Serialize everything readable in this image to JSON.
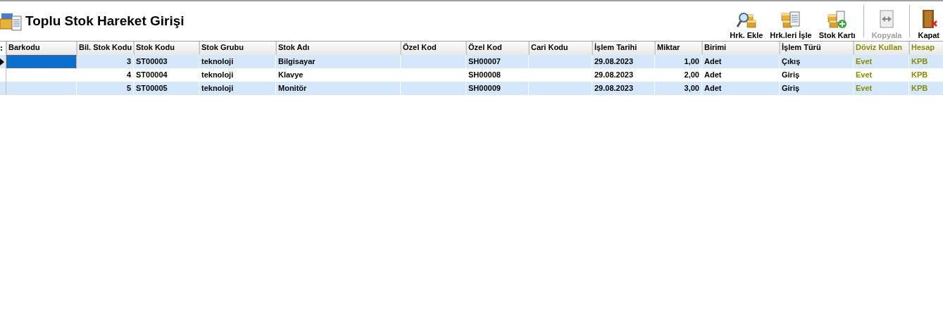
{
  "window": {
    "title": "Toplu Stok Hareket Girişi"
  },
  "toolbar": [
    {
      "label": "Hrk. Ekle",
      "kind": "search",
      "disabled": false
    },
    {
      "label": "Hrk.leri İşle",
      "kind": "document",
      "disabled": false
    },
    {
      "label": "Stok Kartı",
      "kind": "add",
      "disabled": false,
      "separator_after": true
    },
    {
      "label": "Kopyala",
      "kind": "copy",
      "disabled": true,
      "separator_after": true
    },
    {
      "label": "Kapat",
      "kind": "door",
      "disabled": false
    }
  ],
  "table": {
    "columns": [
      {
        "label": "Barkodu",
        "highlight": false
      },
      {
        "label": "Bil. Stok Kodu",
        "numeric": true,
        "highlight": false
      },
      {
        "label": "Stok Kodu",
        "numeric": false,
        "highlight": false
      },
      {
        "label": "Stok Grubu",
        "numeric": false,
        "highlight": false
      },
      {
        "label": "Stok Adı",
        "numeric": false,
        "highlight": false
      },
      {
        "label": "Özel Kod",
        "highlight": false
      },
      {
        "label": "Özel Kod",
        "numeric": false,
        "highlight": false
      },
      {
        "label": "Cari Kodu",
        "highlight": false
      },
      {
        "label": "İşlem Tarihi",
        "numeric": false,
        "highlight": false
      },
      {
        "label": "Miktar",
        "numeric": true,
        "highlight": false
      },
      {
        "label": "Birimi",
        "numeric": false,
        "highlight": false
      },
      {
        "label": "İşlem Türü",
        "numeric": false,
        "highlight": false
      },
      {
        "label": "Döviz Kullan",
        "numeric": false,
        "highlight": true
      },
      {
        "label": "Hesap",
        "numeric": false,
        "highlight": true
      }
    ],
    "rows": [
      {
        "selected": true,
        "cells": [
          "",
          "3",
          "ST00003",
          "teknoloji",
          "Bilgisayar",
          "",
          "SH00007",
          "",
          "29.08.2023",
          "1,00",
          "Adet",
          "Çıkış",
          "Evet",
          "KPB"
        ]
      },
      {
        "selected": false,
        "cells": [
          "",
          "4",
          "ST00004",
          "teknoloji",
          "Klavye",
          "",
          "SH00008",
          "",
          "29.08.2023",
          "2,00",
          "Adet",
          "Giriş",
          "Evet",
          "KPB"
        ]
      },
      {
        "selected": false,
        "cells": [
          "",
          "5",
          "ST00005",
          "teknoloji",
          "Monitör",
          "",
          "SH00009",
          "",
          "29.08.2023",
          "3,00",
          "Adet",
          "Giriş",
          "Evet",
          "KPB"
        ]
      }
    ]
  }
}
